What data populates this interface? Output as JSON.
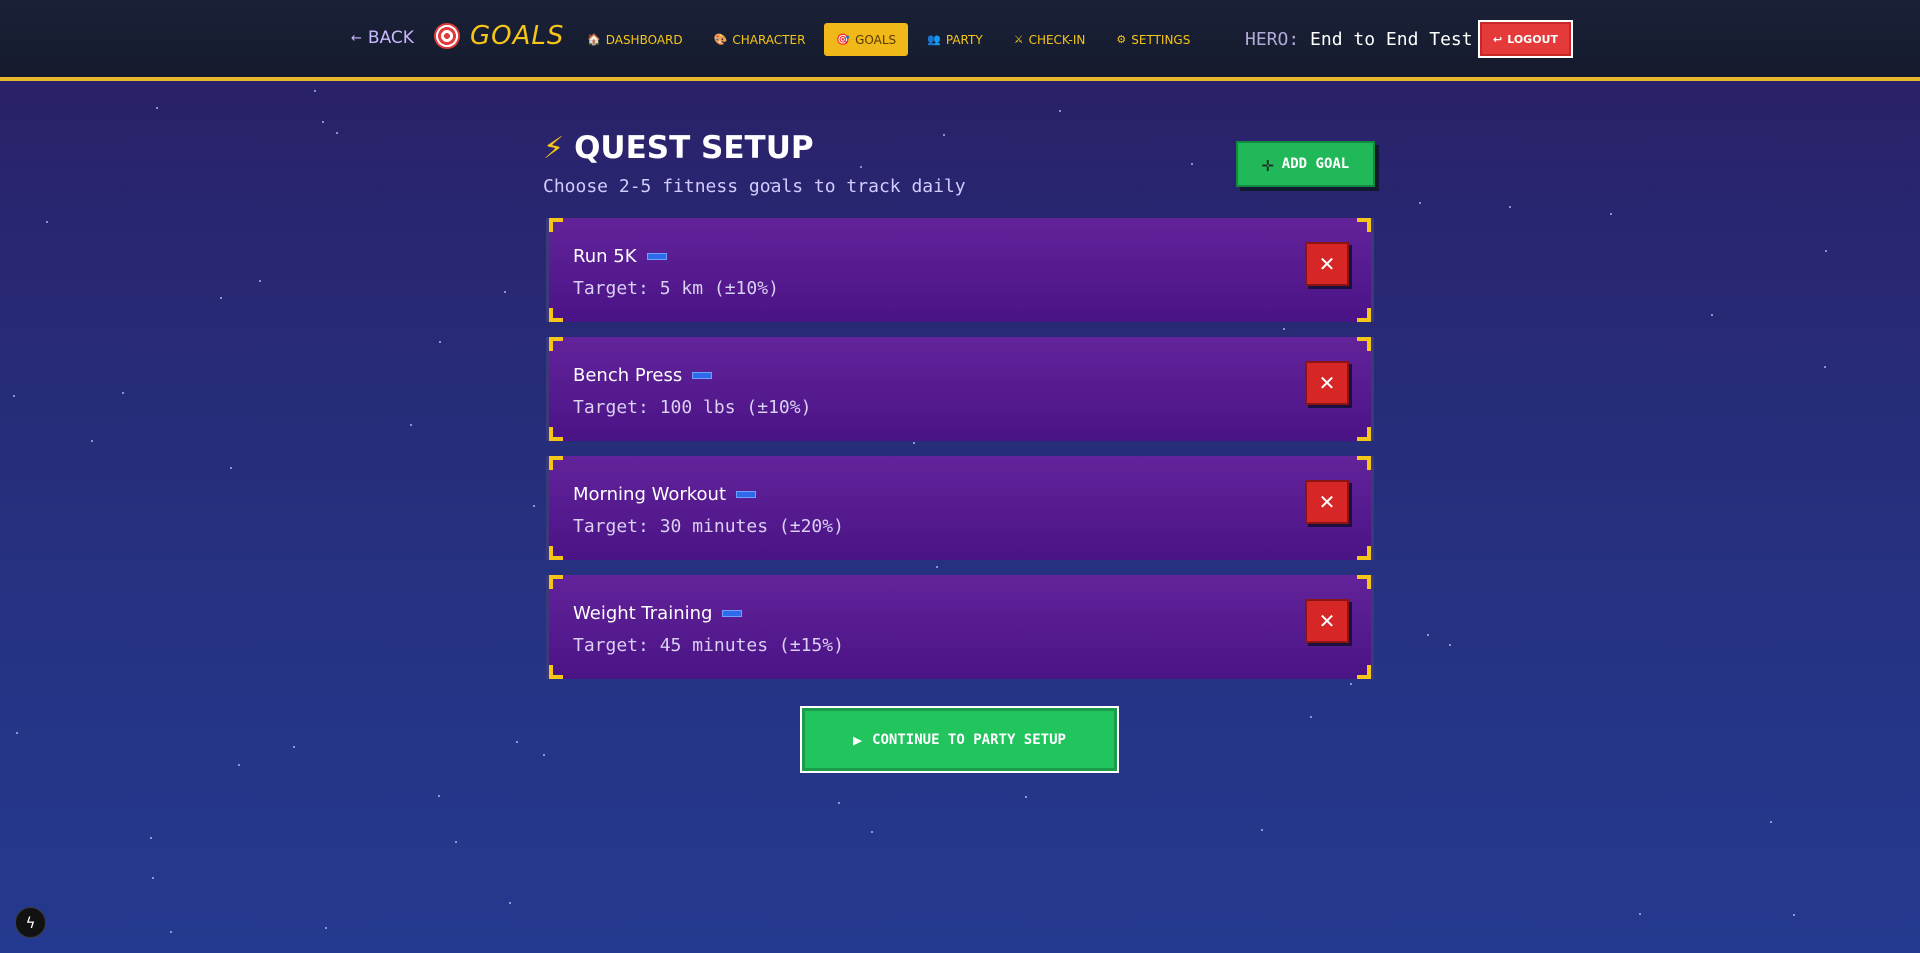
{
  "header": {
    "back_label": "BACK",
    "brand": "GOALS",
    "nav": [
      {
        "label": "DASHBOARD",
        "icon": "house-icon",
        "glyph": "🏠",
        "active": false
      },
      {
        "label": "CHARACTER",
        "icon": "palette-icon",
        "glyph": "🎨",
        "active": false
      },
      {
        "label": "GOALS",
        "icon": "target-icon",
        "glyph": "🎯",
        "active": true
      },
      {
        "label": "PARTY",
        "icon": "people-icon",
        "glyph": "👥",
        "active": false
      },
      {
        "label": "CHECK-IN",
        "icon": "swords-icon",
        "glyph": "⚔",
        "active": false
      },
      {
        "label": "SETTINGS",
        "icon": "gear-icon",
        "glyph": "⚙",
        "active": false
      }
    ],
    "hero_label": "HERO:",
    "hero_name": "End to End Test",
    "logout_label": "LOGOUT"
  },
  "page": {
    "title": "QUEST SETUP",
    "subtitle": "Choose 2-5 fitness goals to track daily",
    "add_goal_label": "ADD GOAL",
    "continue_label": "CONTINUE TO PARTY SETUP"
  },
  "goals": [
    {
      "name": "Run 5K",
      "target": "Target: 5 km (±10%)"
    },
    {
      "name": "Bench Press",
      "target": "Target: 100 lbs (±10%)"
    },
    {
      "name": "Morning Workout",
      "target": "Target: 30 minutes (±20%)"
    },
    {
      "name": "Weight Training",
      "target": "Target: 45 minutes (±15%)"
    }
  ],
  "colors": {
    "accent": "#f5c518",
    "success": "#22c45e",
    "danger": "#d62626",
    "card": "#5a1b92"
  }
}
